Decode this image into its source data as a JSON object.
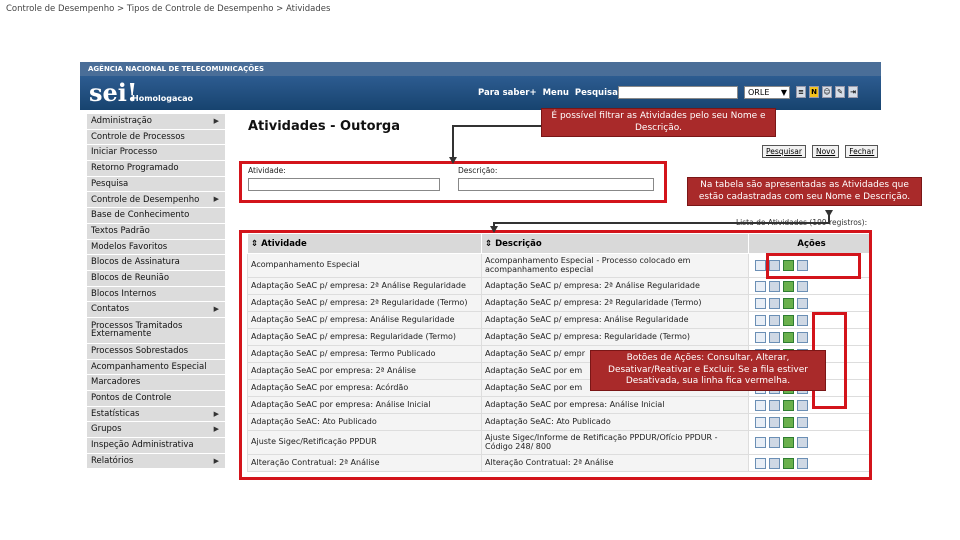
{
  "breadcrumb": "Controle de Desempenho > Tipos de Controle de Desempenho > Atividades",
  "topbar": "AGÊNCIA NACIONAL DE TELECOMUNICAÇÕES",
  "header": {
    "logo": "sei!",
    "env": "Homologacao",
    "nav": [
      "Para saber+",
      "Menu",
      "Pesquisa"
    ],
    "unit": "ORLE",
    "icons": [
      "list-icon",
      "notes-icon",
      "user-icon",
      "tools-icon",
      "exit-icon"
    ]
  },
  "menu": [
    {
      "label": "Administração",
      "sub": true
    },
    {
      "label": "Controle de Processos",
      "sub": false
    },
    {
      "label": "Iniciar Processo",
      "sub": false
    },
    {
      "label": "Retorno Programado",
      "sub": false
    },
    {
      "label": "Pesquisa",
      "sub": false
    },
    {
      "label": "Controle de Desempenho",
      "sub": true
    },
    {
      "label": "Base de Conhecimento",
      "sub": false
    },
    {
      "label": "Textos Padrão",
      "sub": false
    },
    {
      "label": "Modelos Favoritos",
      "sub": false
    },
    {
      "label": "Blocos de Assinatura",
      "sub": false
    },
    {
      "label": "Blocos de Reunião",
      "sub": false
    },
    {
      "label": "Blocos Internos",
      "sub": false
    },
    {
      "label": "Contatos",
      "sub": true
    },
    {
      "label": "Processos Tramitados Externamente",
      "sub": false
    },
    {
      "label": "Processos Sobrestados",
      "sub": false
    },
    {
      "label": "Acompanhamento Especial",
      "sub": false
    },
    {
      "label": "Marcadores",
      "sub": false
    },
    {
      "label": "Pontos de Controle",
      "sub": false
    },
    {
      "label": "Estatísticas",
      "sub": true
    },
    {
      "label": "Grupos",
      "sub": true
    },
    {
      "label": "Inspeção Administrativa",
      "sub": false
    },
    {
      "label": "Relatórios",
      "sub": true
    }
  ],
  "page": {
    "title": "Atividades - Outorga",
    "buttons": [
      "Pesquisar",
      "Novo",
      "Fechar"
    ],
    "filter_labels": {
      "atividade": "Atividade:",
      "descricao": "Descrição:"
    },
    "caption": "Lista de Atividades (199 registros):"
  },
  "table": {
    "headers": [
      "Atividade",
      "Descrição",
      "Ações"
    ],
    "rows": [
      [
        "Acompanhamento Especial",
        "Acompanhamento Especial - Processo colocado em acompanhamento especial"
      ],
      [
        "Adaptação SeAC p/ empresa: 2ª Análise Regularidade",
        "Adaptação SeAC p/ empresa: 2ª Análise Regularidade"
      ],
      [
        "Adaptação SeAC p/ empresa: 2ª Regularidade (Termo)",
        "Adaptação SeAC p/ empresa: 2ª Regularidade (Termo)"
      ],
      [
        "Adaptação SeAC p/ empresa: Análise Regularidade",
        "Adaptação SeAC p/ empresa: Análise Regularidade"
      ],
      [
        "Adaptação SeAC p/ empresa: Regularidade (Termo)",
        "Adaptação SeAC p/ empresa: Regularidade (Termo)"
      ],
      [
        "Adaptação SeAC p/ empresa: Termo Publicado",
        "Adaptação SeAC p/ empr"
      ],
      [
        "Adaptação SeAC por empresa: 2ª Análise",
        "Adaptação SeAC por em"
      ],
      [
        "Adaptação SeAC por empresa: Acórdão",
        "Adaptação SeAC por em"
      ],
      [
        "Adaptação SeAC por empresa: Análise Inicial",
        "Adaptação SeAC por empresa: Análise Inicial"
      ],
      [
        "Adaptação SeAC: Ato Publicado",
        "Adaptação SeAC: Ato Publicado"
      ],
      [
        "Ajuste Sigec/Retificação PPDUR",
        "Ajuste Sigec/Informe de Retificação PPDUR/Ofício PPDUR - Código 248/ 800"
      ],
      [
        "Alteração Contratual: 2ª Análise",
        "Alteração Contratual: 2ª Análise"
      ]
    ]
  },
  "callouts": {
    "filter": "É possível filtrar as Atividades pelo seu Nome e Descrição.",
    "table": "Na tabela são apresentadas as Atividades que estão cadastradas com seu Nome e Descrição.",
    "actions": "Botões de Ações: Consultar, Alterar, Desativar/Reativar e Excluir. Se a fila estiver Desativada, sua linha fica vermelha."
  },
  "colors": {
    "callout": "#a92a2a",
    "highlight": "#d3141b",
    "header": "#2d5c91"
  }
}
